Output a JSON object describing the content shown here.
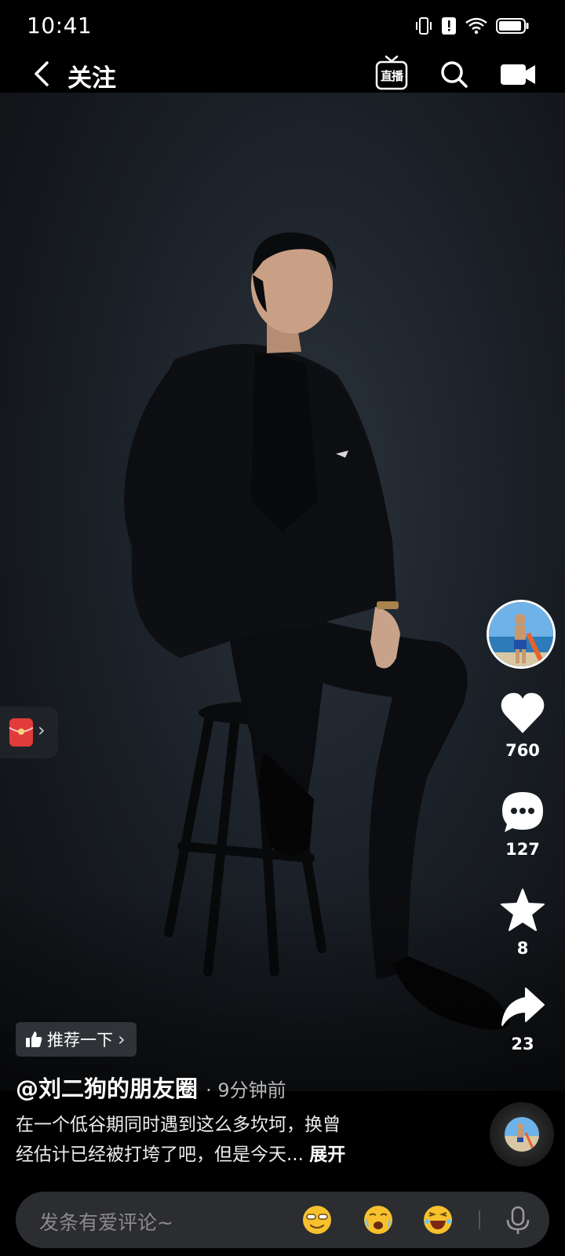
{
  "status_bar": {
    "time": "10:41"
  },
  "nav": {
    "title": "关注",
    "live_label_1": "直",
    "live_label_2": "播"
  },
  "red_packet": {
    "arrow": "›"
  },
  "rail": {
    "likes": "760",
    "comments": "127",
    "favorites": "8",
    "shares": "23"
  },
  "recommend": {
    "label": "推荐一下",
    "chevron": "›"
  },
  "post": {
    "author": "@刘二狗的朋友圈",
    "time_ago": "· 9分钟前",
    "caption_line1": "在一个低谷期同时遇到这么多坎坷，换曾",
    "caption_line2": "经估计已经被打垮了吧，但是今天...",
    "expand": "展开"
  },
  "comment_bar": {
    "placeholder": "发条有爱评论~"
  },
  "colors": {
    "background": "#000000",
    "like": "#ffffff",
    "red_packet": "#e23b3b"
  },
  "icons": [
    "back-icon",
    "live-icon",
    "search-icon",
    "camera-icon",
    "heart-icon",
    "comment-icon",
    "star-icon",
    "share-icon",
    "mic-icon"
  ]
}
